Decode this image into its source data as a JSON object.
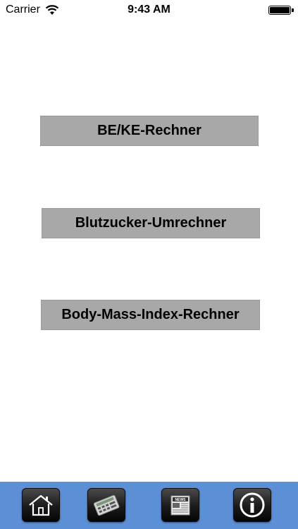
{
  "status_bar": {
    "carrier": "Carrier",
    "time": "9:43 AM",
    "battery_level": 1.0
  },
  "menu": {
    "buttons": [
      {
        "label": "BE/KE-Rechner"
      },
      {
        "label": "Blutzucker-Umrechner"
      },
      {
        "label": "Body-Mass-Index-Rechner"
      }
    ]
  },
  "tab_bar": {
    "background_color": "#5c8fd6",
    "tabs": [
      {
        "icon": "home-icon"
      },
      {
        "icon": "calculator-icon"
      },
      {
        "icon": "news-icon",
        "icon_text": "NEWS"
      },
      {
        "icon": "info-icon"
      }
    ]
  }
}
